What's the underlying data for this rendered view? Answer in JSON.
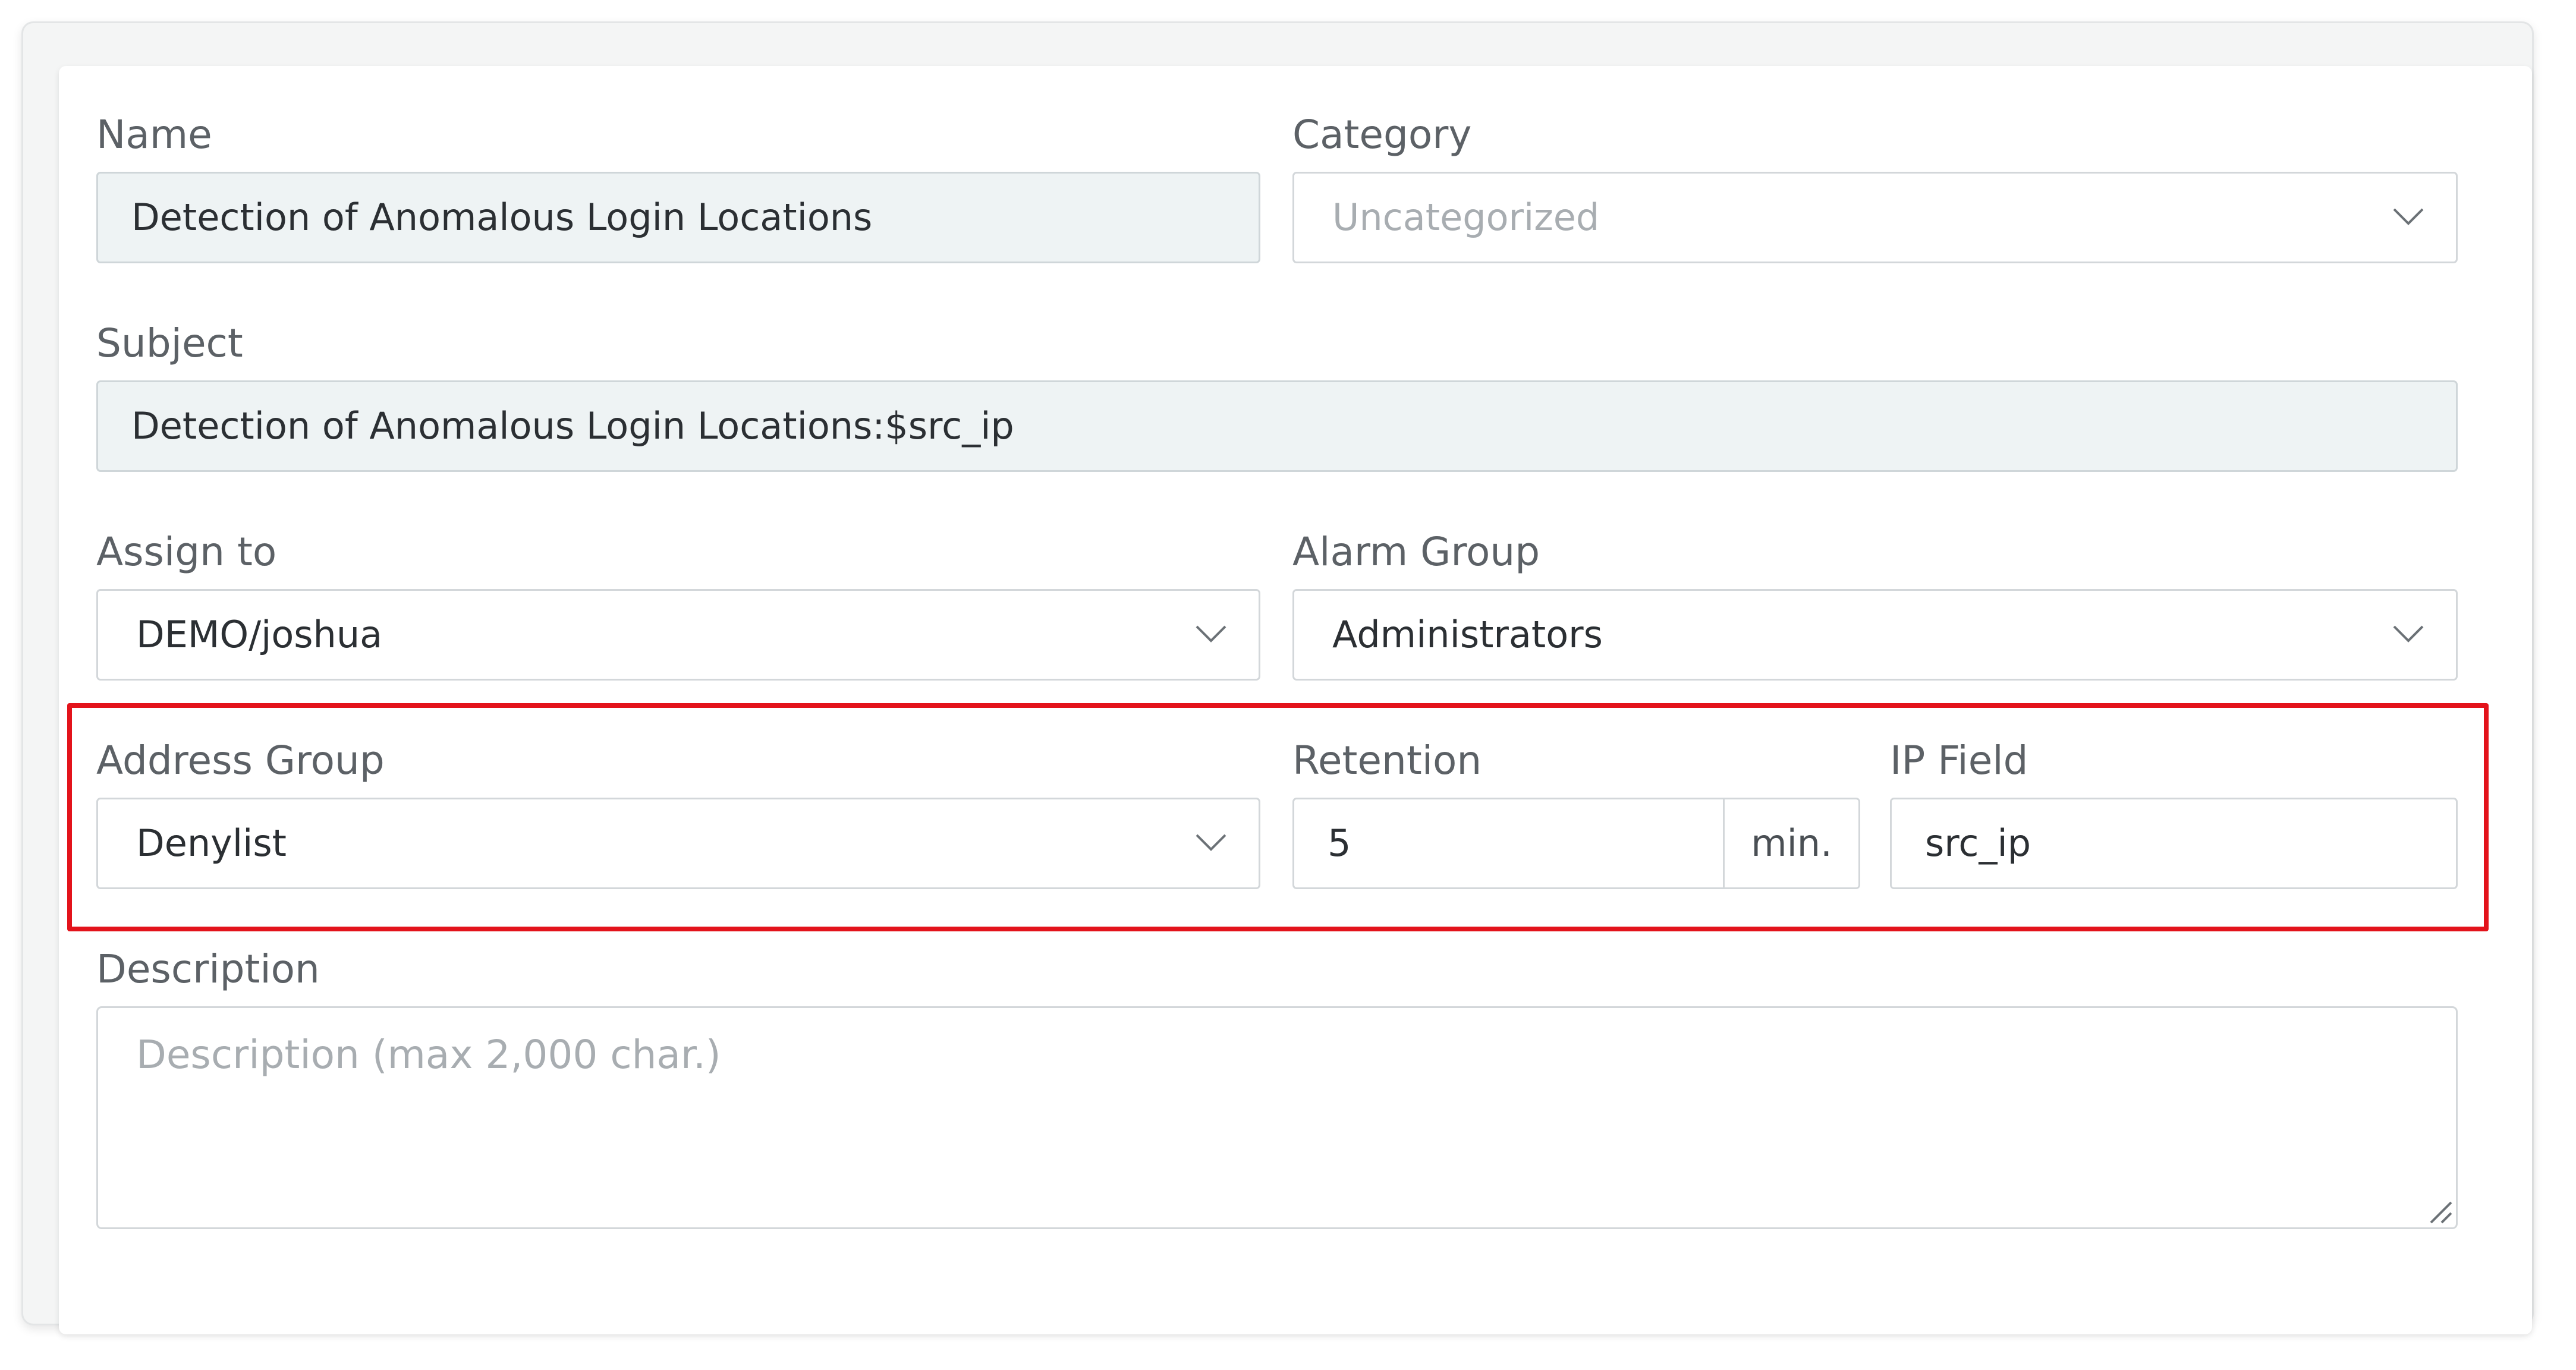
{
  "form": {
    "name": {
      "label": "Name",
      "value": "Detection of Anomalous Login Locations"
    },
    "category": {
      "label": "Category",
      "placeholder": "Uncategorized"
    },
    "subject": {
      "label": "Subject",
      "value": "Detection of Anomalous Login Locations:$src_ip"
    },
    "assign_to": {
      "label": "Assign to",
      "value": "DEMO/joshua"
    },
    "alarm_group": {
      "label": "Alarm Group",
      "value": "Administrators"
    },
    "address_group": {
      "label": "Address Group",
      "value": "Denylist"
    },
    "retention": {
      "label": "Retention",
      "value": "5",
      "unit": "min."
    },
    "ip_field": {
      "label": "IP Field",
      "value": "src_ip"
    },
    "description": {
      "label": "Description",
      "placeholder": "Description (max 2,000 char.)"
    }
  },
  "icons": {
    "dropdown": "chevron-down-icon",
    "resize": "resize-handle-icon"
  },
  "colors": {
    "highlight_border": "#e3131b",
    "readonly_background": "#eef3f4",
    "label_text": "#5c6166",
    "field_border": "#d3d7da"
  }
}
